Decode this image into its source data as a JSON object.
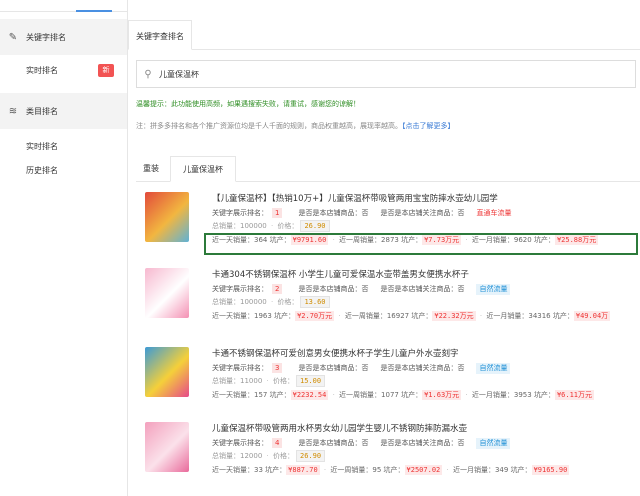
{
  "sidebar": {
    "groups": [
      {
        "icon": "pen-icon",
        "label": "关键字排名",
        "items": [
          {
            "label": "实时排名",
            "badge": "新"
          }
        ]
      },
      {
        "icon": "layers-icon",
        "label": "类目排名",
        "items": [
          {
            "label": "实时排名"
          },
          {
            "label": "历史排名"
          }
        ]
      }
    ]
  },
  "main": {
    "top_tab": "关键字查排名",
    "search": {
      "value": "儿童保温杯"
    },
    "tip": "温馨提示：此功能使用高频，如果遇搜索失败，请重试，感谢您的谅解！",
    "note": "注：拼多多排名和各个推广资源位均是千人千面的规则，商品权重越高，展现率越高。",
    "note_more": "【点击了解更多】",
    "sub_tabs": [
      "重装",
      "儿童保温杯"
    ]
  },
  "labels": {
    "rank": "关键字展示排名：",
    "store": "是否是本店铺商品：否",
    "follow": "是否是本店铺关注商品：否",
    "total": "总销量：",
    "price": "价格：",
    "day": "近一天销量：",
    "week": "近一周销量：",
    "month": "近一月销量：",
    "money": "坑产："
  },
  "products": [
    {
      "title": "【儿童保温杯】【热销10万+】儿童保温杯带吸管两用宝宝防摔水壶幼儿园学",
      "rank": "1",
      "tag": "直通车流量",
      "tag_type": "red",
      "total": "100000",
      "price": "26.90",
      "day": "364",
      "day_money": "¥9791.60",
      "week": "2873",
      "week_money": "¥7.73万元",
      "month": "9620",
      "month_money": "¥25.88万元",
      "colors": [
        "#e24a3b",
        "#f2b640",
        "#5fb2d6"
      ]
    },
    {
      "title": "卡通304不锈钢保温杯 小学生儿童可爱保温水壶带盖男女便携水杯子",
      "rank": "2",
      "tag": "自然流量",
      "tag_type": "blue",
      "total": "100000",
      "price": "13.60",
      "day": "1963",
      "day_money": "¥2.70万元",
      "week": "16927",
      "week_money": "¥22.32万元",
      "month": "34316",
      "month_money": "¥49.04万",
      "colors": [
        "#f7b8cf",
        "#ffffff",
        "#f490b3"
      ]
    },
    {
      "title": "卡通不锈钢保温杯可爱创意男女便携水杯子学生儿童户外水壶刻字",
      "rank": "3",
      "tag": "自然流量",
      "tag_type": "blue",
      "total": "11000",
      "price": "15.00",
      "day": "157",
      "day_money": "¥2232.54",
      "week": "1077",
      "week_money": "¥1.63万元",
      "month": "3953",
      "month_money": "¥6.11万元",
      "colors": [
        "#3c9ad6",
        "#f5d03a",
        "#e6498a"
      ]
    },
    {
      "title": "儿童保温杯带吸管两用水杯男女幼儿园学生婴儿不锈钢防摔防漏水壶",
      "rank": "4",
      "tag": "自然流量",
      "tag_type": "blue",
      "total": "12000",
      "price": "26.90",
      "day": "33",
      "day_money": "¥887.70",
      "week": "95",
      "week_money": "¥2507.02",
      "month": "349",
      "month_money": "¥9165.90",
      "colors": [
        "#f3a0bd",
        "#fbe1ea",
        "#e96a9b"
      ]
    }
  ]
}
